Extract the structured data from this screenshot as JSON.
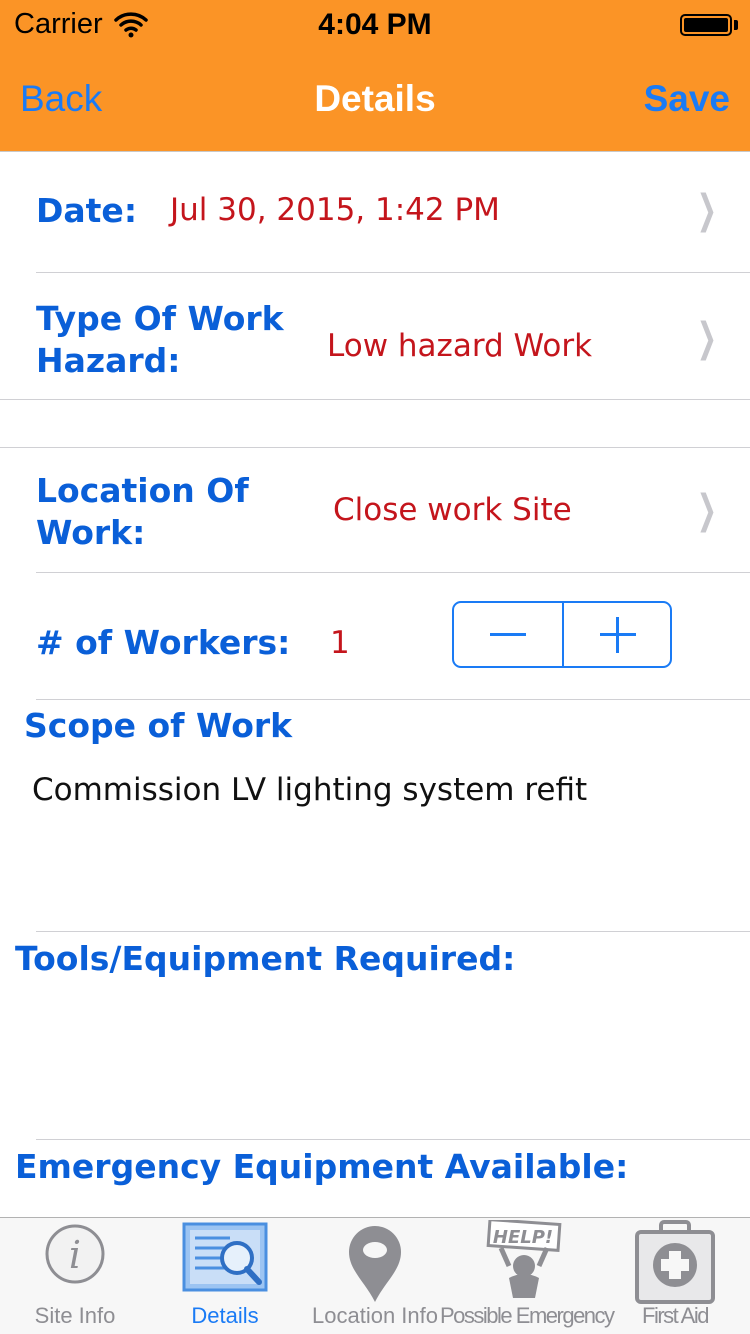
{
  "status_bar": {
    "carrier": "Carrier",
    "time": "4:04 PM"
  },
  "nav": {
    "back": "Back",
    "title": "Details",
    "save": "Save"
  },
  "form": {
    "date": {
      "label": "Date:",
      "value": "Jul 30, 2015, 1:42 PM"
    },
    "hazard": {
      "label": "Type Of Work Hazard:",
      "value": "Low hazard Work"
    },
    "location": {
      "label": "Location Of Work:",
      "value": "Close work Site"
    },
    "workers": {
      "label": "# of Workers:",
      "value": "1"
    },
    "scope": {
      "label": "Scope of Work",
      "value": "Commission LV lighting system refit"
    },
    "tools": {
      "label": "Tools/Equipment Required:"
    },
    "emergency": {
      "label": "Emergency Equipment Available:"
    }
  },
  "tabs": [
    {
      "label": "Site Info",
      "icon": "info-icon",
      "active": false
    },
    {
      "label": "Details",
      "icon": "magnifier-document-icon",
      "active": true
    },
    {
      "label": "Location Info",
      "icon": "map-pin-icon",
      "active": false
    },
    {
      "label": "Possible Emergency",
      "icon": "help-sign-icon",
      "active": false
    },
    {
      "label": "First Aid",
      "icon": "first-aid-kit-icon",
      "active": false
    }
  ],
  "colors": {
    "nav_background": "#fb9426",
    "accent": "#1a7bf5",
    "label": "#0a5fd8",
    "value": "#c4151c"
  }
}
